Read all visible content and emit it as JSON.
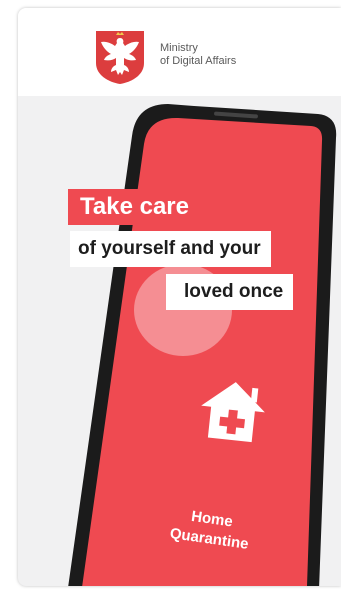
{
  "header": {
    "ministry_line1": "Ministry",
    "ministry_line2": "of Digital Affairs",
    "emblem_icon": "polish-eagle-emblem"
  },
  "promo": {
    "headline": "Take care",
    "line2": "of yourself and your",
    "line3": "loved once"
  },
  "app": {
    "icon": "house-medical-cross-icon",
    "label_line1": "Home",
    "label_line2": "Quarantine"
  },
  "colors": {
    "brand_red": "#ef4a51",
    "phone_frame": "#1b1b1b",
    "card_background": "#f1f1f2",
    "header_background": "#ffffff"
  }
}
